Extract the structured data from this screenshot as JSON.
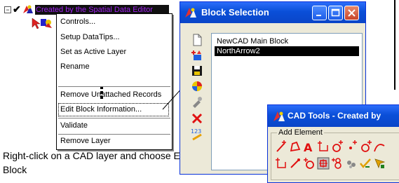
{
  "tree": {
    "expand_glyph": "⊟",
    "check_glyph": "✔",
    "layer_name": "Created by the Spatial Data Editor",
    "icons": [
      "checkmark-icon",
      "cad-layer-icon",
      "cad-symbol-icon"
    ]
  },
  "context_menu": {
    "items": [
      "Controls...",
      "Setup DataTips...",
      "Set as Active Layer",
      "Rename",
      "Remove Unattached Records",
      "Edit Block Information...",
      "Validate",
      "Remove Layer"
    ],
    "more_indicator_icon": "vertical-ellipsis-icon"
  },
  "caption": "Right-click on a CAD layer and choose Edit Block",
  "block_selection": {
    "title": "Block Selection",
    "list_items": [
      "NewCAD  Main Block",
      "NorthArrow2"
    ],
    "selected_index": 1,
    "toolbar_icons": [
      "new-block-icon",
      "add-block-icon",
      "save-icon",
      "color-icon",
      "pen-icon",
      "delete-icon",
      "numbering-icon"
    ],
    "title_buttons": [
      "minimize-icon",
      "maximize-icon",
      "close-icon"
    ]
  },
  "cad_tools": {
    "title": "CAD Tools - Created by",
    "group_label": "Add Element",
    "tool_icons": [
      "line-tool-icon",
      "polygon-tool-icon",
      "text-tool-icon",
      "point-tool-icon",
      "node-tool-icon",
      "curve-tool-icon",
      "arc-tool-icon",
      "freehand-tool-icon",
      "circle-tool-icon",
      "rectangle-tool-icon",
      "ellipse-tool-icon",
      "symbol-tool-icon",
      "check-tool-icon",
      "misc-tool-icon"
    ]
  },
  "colors": {
    "titlebar": "#0a4fd8",
    "window_bg": "#ece9d8",
    "selected_bg": "#000000",
    "layer_name_text": "#a020f0",
    "close_button": "#c8442a"
  }
}
